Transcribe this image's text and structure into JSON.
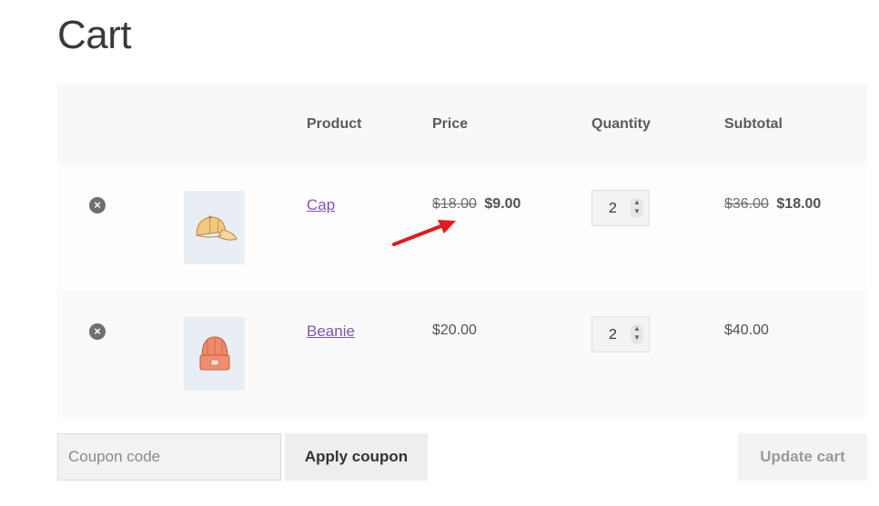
{
  "page": {
    "title": "Cart"
  },
  "table": {
    "headers": {
      "product": "Product",
      "price": "Price",
      "quantity": "Quantity",
      "subtotal": "Subtotal"
    },
    "items": [
      {
        "name": "Cap",
        "regular_price": "$18.00",
        "sale_price": "$9.00",
        "quantity": "2",
        "regular_subtotal": "$36.00",
        "sale_subtotal": "$18.00",
        "thumbnail_icon": "cap-icon"
      },
      {
        "name": "Beanie",
        "price": "$20.00",
        "quantity": "2",
        "subtotal": "$40.00",
        "thumbnail_icon": "beanie-icon"
      }
    ]
  },
  "actions": {
    "coupon_placeholder": "Coupon code",
    "apply_coupon_label": "Apply coupon",
    "update_cart_label": "Update cart"
  },
  "annotation": {
    "arrow_color": "#e01b1b"
  },
  "colors": {
    "link": "#7f54b3"
  }
}
